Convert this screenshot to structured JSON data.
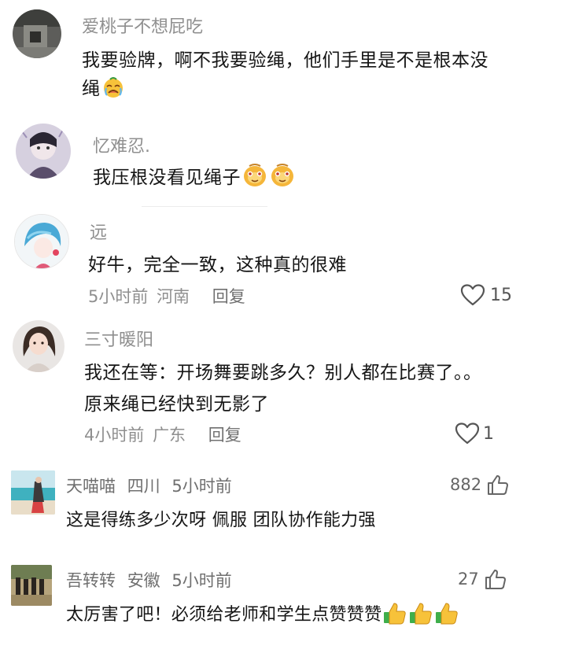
{
  "comments": [
    {
      "username": "爱桃子不想屁吃",
      "text_line1": "我要验牌，啊不我要验绳，他们手里是不是根本没",
      "text_line2": "绳",
      "emoji": "crying-face"
    },
    {
      "username": "忆难忍.",
      "text": "我压根没看见绳子",
      "emoji": "dog-head-smirk"
    },
    {
      "username": "远",
      "text": "好牛，完全一致，这种真的很难",
      "time": "5小时前",
      "location": "河南",
      "reply_label": "回复",
      "likes": "15"
    },
    {
      "username": "三寸暖阳",
      "text_line1": "我还在等：开场舞要跳多久？别人都在比赛了。。",
      "text_line2": "原来绳已经快到无影了",
      "time": "4小时前",
      "location": "广东",
      "reply_label": "回复",
      "likes": "1"
    },
    {
      "username": "天喵喵",
      "location": "四川",
      "time": "5小时前",
      "text": "这是得练多少次呀 佩服 团队协作能力强",
      "likes": "882"
    },
    {
      "username": "吾转转",
      "location": "安徽",
      "time": "5小时前",
      "text": "太厉害了吧！必须给老师和学生点赞赞赞",
      "likes": "27",
      "emoji": "thumbs-up"
    }
  ],
  "colors": {
    "meta_gray": "#8f8f8f",
    "text": "#161616",
    "emoji_yellow": "#f7c23a",
    "thumb_sleeve": "#3fae4b"
  }
}
